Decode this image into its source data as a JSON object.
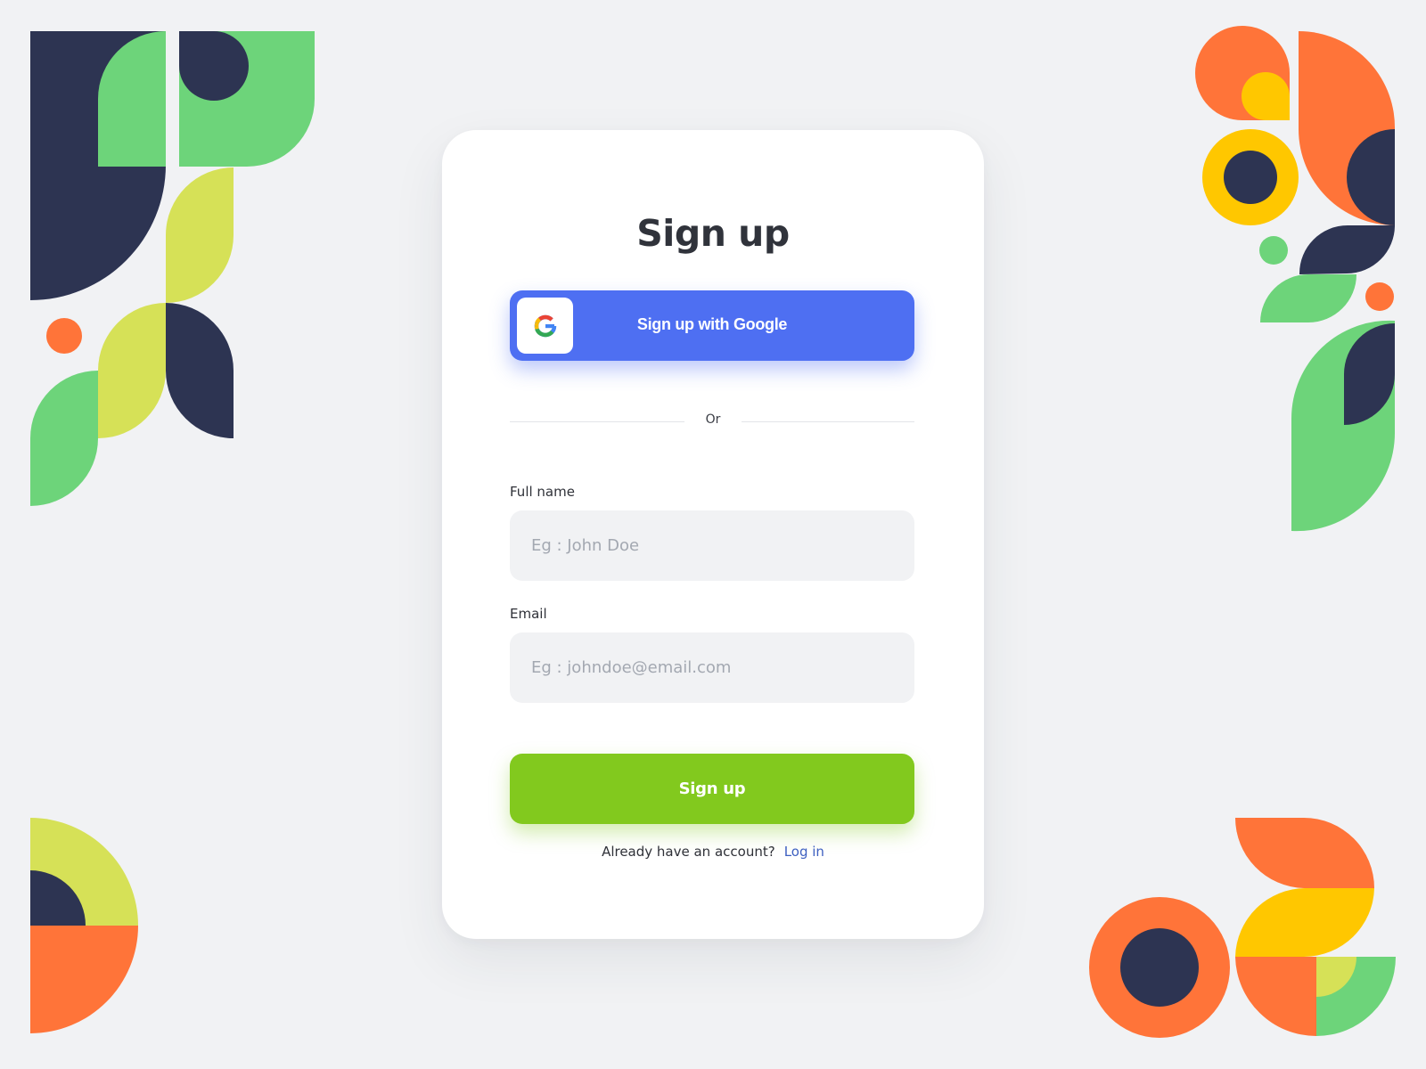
{
  "title": "Sign up",
  "google_button": {
    "label": "Sign up with Google",
    "icon": "google-logo-icon"
  },
  "divider": {
    "text": "Or"
  },
  "fields": {
    "full_name": {
      "label": "Full name",
      "placeholder": "Eg : John Doe",
      "value": ""
    },
    "email": {
      "label": "Email",
      "placeholder": "Eg : johndoe@email.com",
      "value": ""
    }
  },
  "signup_button": {
    "label": "Sign up"
  },
  "footer": {
    "text": "Already have an account?",
    "link": "Log in"
  },
  "colors": {
    "background": "#f1f2f4",
    "google_blue": "#4e6ff2",
    "signup_green": "#82c91e",
    "link_blue": "#3d5fc0",
    "deco_navy": "#2d3452",
    "deco_green": "#6dd47a",
    "deco_lime": "#d6e157",
    "deco_orange": "#ff7439",
    "deco_yellow": "#ffc700"
  }
}
